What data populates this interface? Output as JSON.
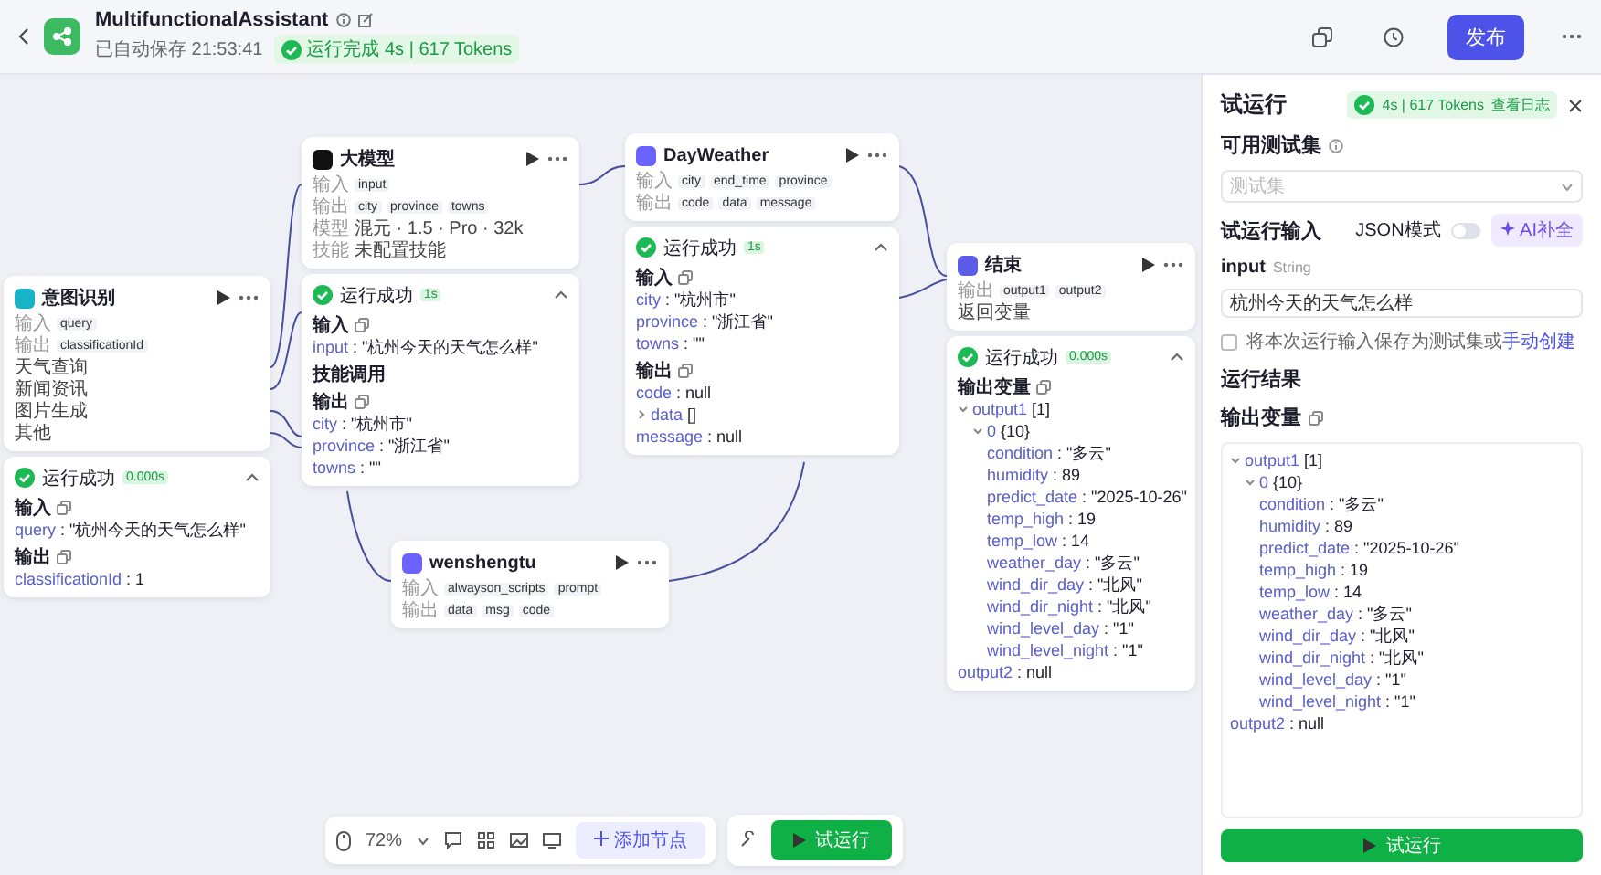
{
  "header": {
    "title": "MultifunctionalAssistant",
    "autosave": "已自动保存 21:53:41",
    "status": "运行完成 4s | 617 Tokens",
    "publish": "发布"
  },
  "nodes": [
    {
      "kind": "intent",
      "title": "意图识别",
      "rows": [
        {
          "label": "输入",
          "tags": [
            "query"
          ]
        },
        {
          "label": "输出",
          "tags": [
            "classificationId"
          ]
        }
      ],
      "branches": [
        "天气查询",
        "新闻资讯",
        "图片生成",
        "其他"
      ],
      "result": {
        "status": "运行成功",
        "time": "0.000s",
        "sections": [
          {
            "title": "输入",
            "lines": [
              {
                "key": "query",
                "value": " : \"杭州今天的天气怎么样\""
              }
            ]
          },
          {
            "title": "输出",
            "lines": [
              {
                "key": "classificationId",
                "value": " : 1"
              }
            ]
          }
        ]
      }
    },
    {
      "kind": "llm",
      "title": "大模型",
      "rows": [
        {
          "label": "输入",
          "tags": [
            "input"
          ]
        },
        {
          "label": "输出",
          "tags": [
            "city",
            "province",
            "towns"
          ]
        },
        {
          "label": "模型",
          "text": "混元 · 1.5 · Pro · 32k"
        },
        {
          "label": "技能",
          "text": "未配置技能"
        }
      ],
      "result": {
        "status": "运行成功",
        "time": "1s",
        "sections": [
          {
            "title": "输入",
            "lines": [
              {
                "key": "input",
                "value": " : \"杭州今天的天气怎么样\""
              }
            ]
          },
          {
            "title": "技能调用"
          },
          {
            "title": "输出",
            "lines": [
              {
                "key": "city",
                "value": " : \"杭州市\""
              },
              {
                "key": "province",
                "value": " : \"浙江省\""
              },
              {
                "key": "towns",
                "value": " : \"\""
              }
            ]
          }
        ]
      }
    },
    {
      "kind": "plugin",
      "title": "DayWeather",
      "rows": [
        {
          "label": "输入",
          "tags": [
            "city",
            "end_time",
            "province"
          ]
        },
        {
          "label": "输出",
          "tags": [
            "code",
            "data",
            "message"
          ]
        }
      ],
      "result": {
        "status": "运行成功",
        "time": "1s",
        "sections": [
          {
            "title": "输入",
            "lines": [
              {
                "key": "city",
                "value": " : \"杭州市\""
              },
              {
                "key": "province",
                "value": " : \"浙江省\""
              },
              {
                "key": "towns",
                "value": " : \"\""
              }
            ]
          },
          {
            "title": "输出",
            "lines": [
              {
                "key": "code",
                "value": " : null"
              },
              {
                "key": "data",
                "value": " []",
                "expanded": false
              },
              {
                "key": "message",
                "value": " : null"
              }
            ]
          }
        ]
      }
    },
    {
      "kind": "plugin",
      "title": "wenshengtu",
      "rows": [
        {
          "label": "输入",
          "tags": [
            "alwayson_scripts",
            "prompt"
          ]
        },
        {
          "label": "输出",
          "tags": [
            "data",
            "msg",
            "code"
          ]
        }
      ]
    },
    {
      "kind": "end",
      "title": "结束",
      "rows": [
        {
          "label": "输出",
          "tags": [
            "output1",
            "output2"
          ]
        },
        {
          "text": "返回变量"
        }
      ],
      "result": {
        "status": "运行成功",
        "time": "0.000s",
        "sections": [
          {
            "title": "输出变量",
            "lines": [
              {
                "key": "output1",
                "value": " [1]",
                "expanded": true,
                "children": [
                  {
                    "key": "0",
                    "value": " {10}",
                    "expanded": true,
                    "children": [
                      {
                        "key": "condition",
                        "value": " : \"多云\""
                      },
                      {
                        "key": "humidity",
                        "value": " : 89"
                      },
                      {
                        "key": "predict_date",
                        "value": " : \"2025-10-26\""
                      },
                      {
                        "key": "temp_high",
                        "value": " : 19"
                      },
                      {
                        "key": "temp_low",
                        "value": " : 14"
                      },
                      {
                        "key": "weather_day",
                        "value": " : \"多云\""
                      },
                      {
                        "key": "wind_dir_day",
                        "value": " : \"北风\""
                      },
                      {
                        "key": "wind_dir_night",
                        "value": " : \"北风\""
                      },
                      {
                        "key": "wind_level_day",
                        "value": " : \"1\""
                      },
                      {
                        "key": "wind_level_night",
                        "value": " : \"1\""
                      }
                    ]
                  }
                ]
              },
              {
                "key": "output2",
                "value": " : null"
              }
            ]
          }
        ]
      }
    }
  ],
  "toolbar": {
    "zoom": "72%",
    "add_node": "添加节点",
    "run": "试运行"
  },
  "panel": {
    "title": "试运行",
    "badge": "4s | 617 Tokens",
    "log_link": "查看日志",
    "testset_label": "可用测试集",
    "testset_placeholder": "测试集",
    "input_title": "试运行输入",
    "json_mode": {
      "label": "JSON模式",
      "on": false
    },
    "ai_button": "AI补全",
    "field": {
      "name": "input",
      "type": "String",
      "value": "杭州今天的天气怎么样"
    },
    "save": {
      "checked": false,
      "text": "将本次运行输入保存为测试集或",
      "link": "手动创建"
    },
    "result_title": "运行结果",
    "output_title": "输出变量",
    "tree": [
      {
        "key": "output1",
        "value": " [1]",
        "expanded": true,
        "children": [
          {
            "key": "0",
            "value": " {10}",
            "expanded": true,
            "children": [
              {
                "key": "condition",
                "value": " : \"多云\""
              },
              {
                "key": "humidity",
                "value": " : 89"
              },
              {
                "key": "predict_date",
                "value": " : \"2025-10-26\""
              },
              {
                "key": "temp_high",
                "value": " : 19"
              },
              {
                "key": "temp_low",
                "value": " : 14"
              },
              {
                "key": "weather_day",
                "value": " : \"多云\""
              },
              {
                "key": "wind_dir_day",
                "value": " : \"北风\""
              },
              {
                "key": "wind_dir_night",
                "value": " : \"北风\""
              },
              {
                "key": "wind_level_day",
                "value": " : \"1\""
              },
              {
                "key": "wind_level_night",
                "value": " : \"1\""
              }
            ]
          }
        ]
      },
      {
        "key": "output2",
        "value": " : null"
      }
    ],
    "run_button": "试运行"
  }
}
